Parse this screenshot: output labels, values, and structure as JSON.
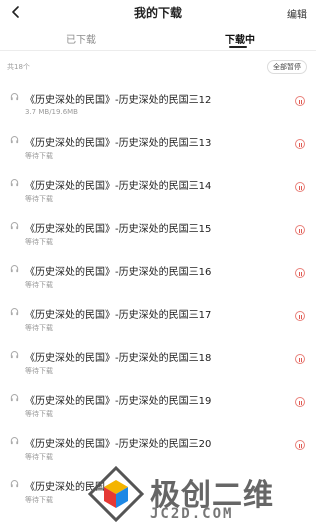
{
  "header": {
    "title": "我的下载",
    "edit_label": "编辑"
  },
  "tabs": [
    {
      "label": "已下载"
    },
    {
      "label": "下载中"
    }
  ],
  "count_text": "共18个",
  "pause_all_label": "全部暂停",
  "items": [
    {
      "title": "《历史深处的民国》-历史深处的民国三12",
      "status": "3.7 MB/19.6MB"
    },
    {
      "title": "《历史深处的民国》-历史深处的民国三13",
      "status": "等待下载"
    },
    {
      "title": "《历史深处的民国》-历史深处的民国三14",
      "status": "等待下载"
    },
    {
      "title": "《历史深处的民国》-历史深处的民国三15",
      "status": "等待下载"
    },
    {
      "title": "《历史深处的民国》-历史深处的民国三16",
      "status": "等待下载"
    },
    {
      "title": "《历史深处的民国》-历史深处的民国三17",
      "status": "等待下载"
    },
    {
      "title": "《历史深处的民国》-历史深处的民国三18",
      "status": "等待下载"
    },
    {
      "title": "《历史深处的民国》-历史深处的民国三19",
      "status": "等待下载"
    },
    {
      "title": "《历史深处的民国》-历史深处的民国三20",
      "status": "等待下载"
    },
    {
      "title": "《历史深处的民国",
      "status": "等待下载"
    }
  ],
  "watermark": {
    "text": "极创二维",
    "url": "JC2D.COM"
  }
}
